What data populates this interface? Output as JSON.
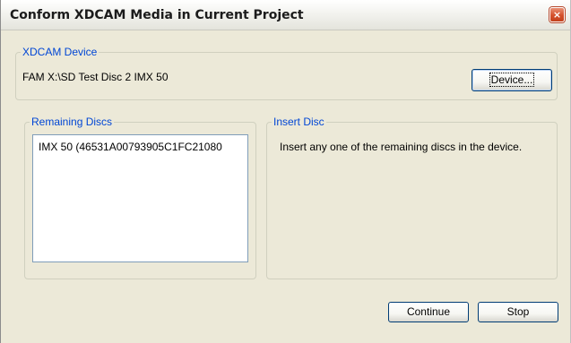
{
  "window": {
    "title": "Conform XDCAM Media in Current Project",
    "close_label": "×"
  },
  "xdcam_device": {
    "legend": "XDCAM Device",
    "path": "FAM X:\\SD Test Disc 2 IMX 50",
    "device_button": "Device..."
  },
  "remaining_discs": {
    "legend": "Remaining Discs",
    "items": [
      "IMX 50 (46531A00793905C1FC21080"
    ]
  },
  "insert_disc": {
    "legend": "Insert Disc",
    "message": "Insert any one of the remaining discs in the device."
  },
  "actions": {
    "continue_label": "Continue",
    "stop_label": "Stop"
  },
  "colors": {
    "accent": "#0046d5",
    "dialog_bg": "#ece9d8",
    "close_button": "#d4512c"
  }
}
